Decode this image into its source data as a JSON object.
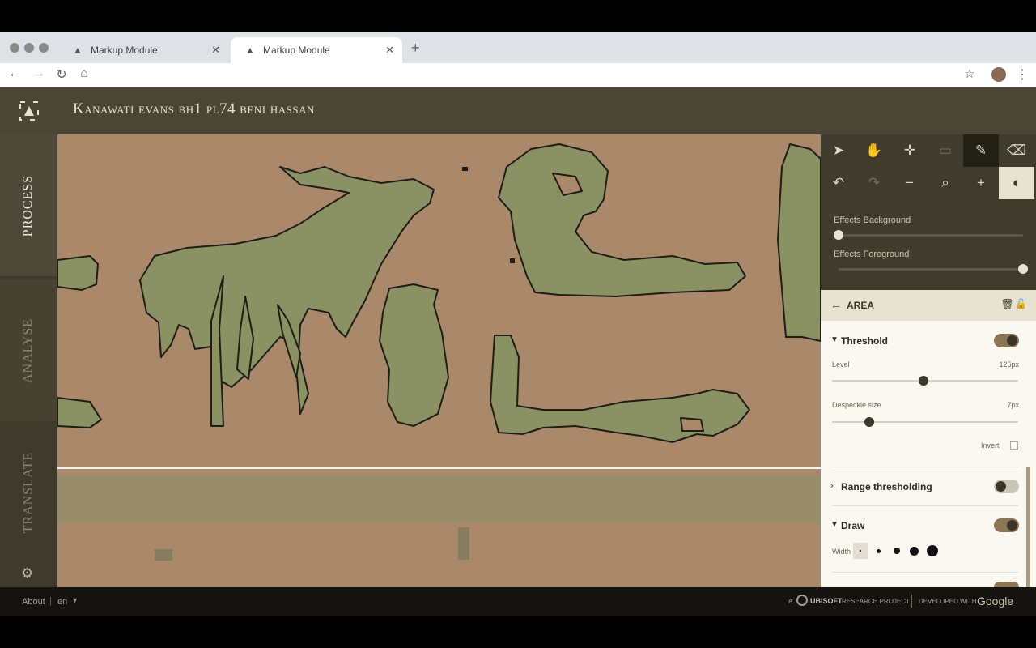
{
  "browser": {
    "tabs": [
      {
        "title": "Markup Module"
      },
      {
        "title": "Markup Module"
      }
    ]
  },
  "app": {
    "title": "Kanawati evans bh1 pl74 beni hassan",
    "nav": {
      "process": "PROCESS",
      "analyse": "ANALYSE",
      "translate": "TRANSLATE"
    }
  },
  "tools": {
    "effects_background_label": "Effects Background",
    "effects_background_value": 0,
    "effects_foreground_label": "Effects Foreground",
    "effects_foreground_value": 1
  },
  "area": {
    "title": "AREA",
    "threshold": {
      "label": "Threshold",
      "enabled": true,
      "level_label": "Level",
      "level_value": "125px",
      "level_fraction": 0.49,
      "despeckle_label": "Despeckle size",
      "despeckle_value": "7px",
      "despeckle_fraction": 0.2,
      "invert_label": "Invert"
    },
    "range": {
      "label": "Range thresholding",
      "enabled": false
    },
    "draw": {
      "label": "Draw",
      "enabled": true,
      "width_label": "Width"
    }
  },
  "footer": {
    "about": "About",
    "lang": "en",
    "ubisoft_prefix": "A",
    "ubisoft_brand": "UBISOFT",
    "ubisoft_suffix": "RESEARCH PROJECT",
    "developed": "DEVELOPED WITH",
    "google": "Google"
  },
  "colors": {
    "canvas": "#a9896a",
    "shape_fill": "#8a9163",
    "header": "#4a4535",
    "accent": "#8c7555"
  }
}
